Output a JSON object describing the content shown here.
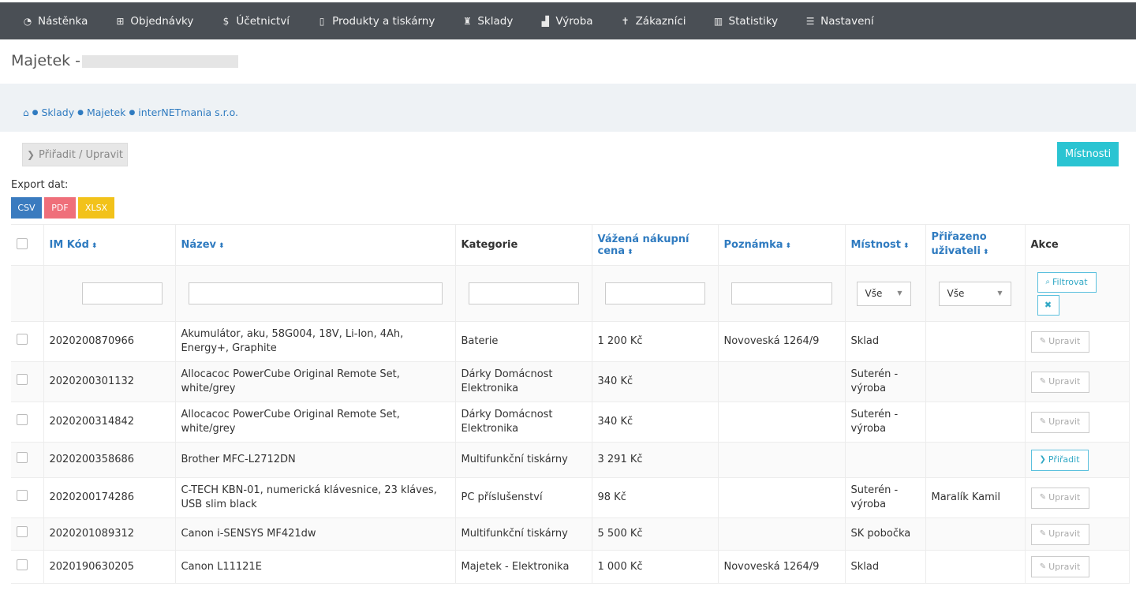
{
  "nav": [
    {
      "icon": "dashboard-icon",
      "glyph": "◔",
      "label": "Nástěnka"
    },
    {
      "icon": "cart-icon",
      "glyph": "⊞",
      "label": "Objednávky"
    },
    {
      "icon": "dollar-icon",
      "glyph": "$",
      "label": "Účetnictví"
    },
    {
      "icon": "file-icon",
      "glyph": "▯",
      "label": "Produkty a tiskárny"
    },
    {
      "icon": "warehouse-icon",
      "glyph": "♜",
      "label": "Sklady"
    },
    {
      "icon": "factory-icon",
      "glyph": "▟",
      "label": "Výroba"
    },
    {
      "icon": "user-icon",
      "glyph": "✝",
      "label": "Zákazníci"
    },
    {
      "icon": "bar-chart-icon",
      "glyph": "▥",
      "label": "Statistiky"
    },
    {
      "icon": "list-icon",
      "glyph": "☰",
      "label": "Nastavení"
    }
  ],
  "page": {
    "title": "Majetek -"
  },
  "breadcrumb": {
    "home_glyph": "⌂",
    "items": [
      "Sklady",
      "Majetek",
      "interNETmania s.r.o."
    ]
  },
  "toolbar": {
    "assign_edit": "Přiřadit / Upravit",
    "rooms": "Místnosti"
  },
  "export": {
    "label": "Export dat:",
    "csv": "CSV",
    "pdf": "PDF",
    "xlsx": "XLSX"
  },
  "table": {
    "headers": {
      "code": "IM Kód",
      "name": "Název",
      "category": "Kategorie",
      "price": "Vážená nákupní cena",
      "note": "Poznámka",
      "room": "Místnost",
      "assigned": "Přiřazeno uživateli",
      "actions": "Akce"
    },
    "filters": {
      "room_select": "Vše",
      "assigned_select": "Vše",
      "filter_btn": "Filtrovat"
    },
    "rows": [
      {
        "code": "2020200870966",
        "name": "Akumulátor, aku, 58G004, 18V, Li-Ion, 4Ah, Energy+, Graphite",
        "category": "Baterie",
        "price": "1 200 Kč",
        "note": "Novoveská 1264/9",
        "room": "Sklad",
        "assigned": "",
        "action": "Upravit"
      },
      {
        "code": "2020200301132",
        "name": "Allocacoc PowerCube Original Remote Set, white/grey",
        "category": "Dárky Domácnost Elektronika",
        "price": "340 Kč",
        "note": "",
        "room": "Suterén - výroba",
        "assigned": "",
        "action": "Upravit"
      },
      {
        "code": "2020200314842",
        "name": "Allocacoc PowerCube Original Remote Set, white/grey",
        "category": "Dárky Domácnost Elektronika",
        "price": "340 Kč",
        "note": "",
        "room": "Suterén - výroba",
        "assigned": "",
        "action": "Upravit"
      },
      {
        "code": "2020200358686",
        "name": "Brother MFC-L2712DN",
        "category": "Multifunkční tiskárny",
        "price": "3 291 Kč",
        "note": "",
        "room": "",
        "assigned": "",
        "action": "Přiřadit"
      },
      {
        "code": "2020200174286",
        "name": "C-TECH KBN-01, numerická klávesnice, 23 kláves, USB slim black",
        "category": "PC příslušenství",
        "price": "98 Kč",
        "note": "",
        "room": "Suterén - výroba",
        "assigned": "Maralík Kamil",
        "action": "Upravit"
      },
      {
        "code": "2020201089312",
        "name": "Canon i-SENSYS MF421dw",
        "category": "Multifunkční tiskárny",
        "price": "5 500 Kč",
        "note": "",
        "room": "SK pobočka",
        "assigned": "",
        "action": "Upravit"
      },
      {
        "code": "2020190630205",
        "name": "Canon L11121E",
        "category": "Majetek - Elektronika",
        "price": "1 000 Kč",
        "note": "Novoveská 1264/9",
        "room": "Sklad",
        "assigned": "",
        "action": "Upravit"
      }
    ]
  }
}
